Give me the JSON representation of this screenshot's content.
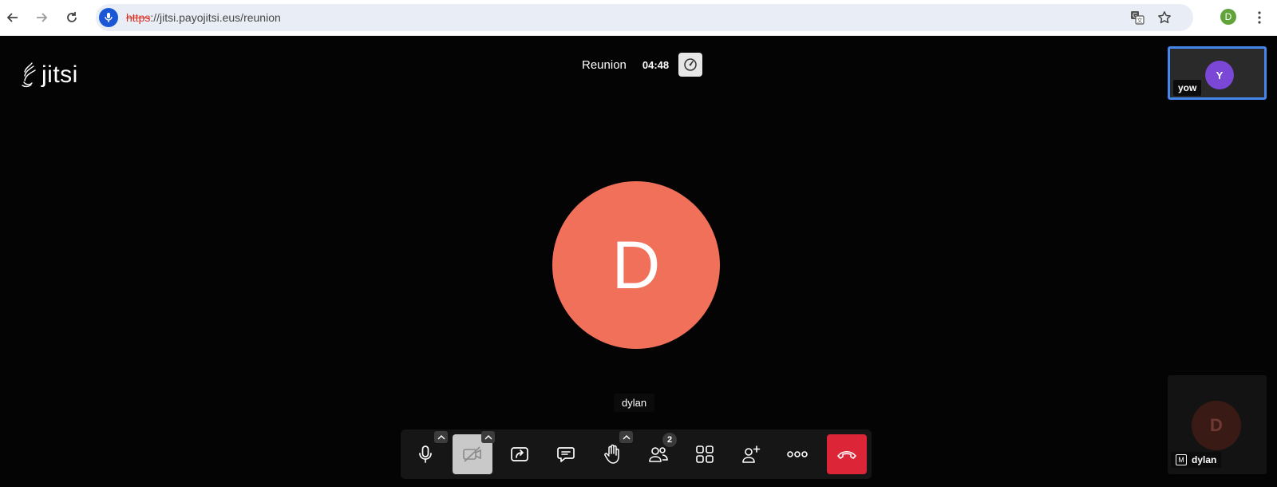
{
  "browser": {
    "url_scheme": "https",
    "url_rest": "://jitsi.payojitsi.eus/reunion",
    "profile_initial": "D",
    "icons": [
      "back-icon",
      "forward-icon",
      "reload-icon",
      "mic-icon",
      "translate-icon",
      "star-icon",
      "menu-icon"
    ]
  },
  "app": {
    "logo_text": "jitsi",
    "meeting_name": "Reunion",
    "timer": "04:48"
  },
  "main_participant": {
    "initial": "D",
    "name": "dylan",
    "avatar_color": "#f17059"
  },
  "remote_thumb": {
    "initial": "Y",
    "name": "yow",
    "avatar_color": "#7b47d7"
  },
  "local_thumb": {
    "initial": "D",
    "name": "dylan",
    "moderator_badge": "M"
  },
  "toolbar": {
    "participants_count": "2",
    "buttons": [
      "microphone",
      "camera",
      "share-screen",
      "chat",
      "raise-hand",
      "participants",
      "tile-view",
      "invite",
      "more",
      "leave"
    ]
  },
  "colors": {
    "hangup": "#dc2638",
    "active_border": "#4687ed"
  }
}
